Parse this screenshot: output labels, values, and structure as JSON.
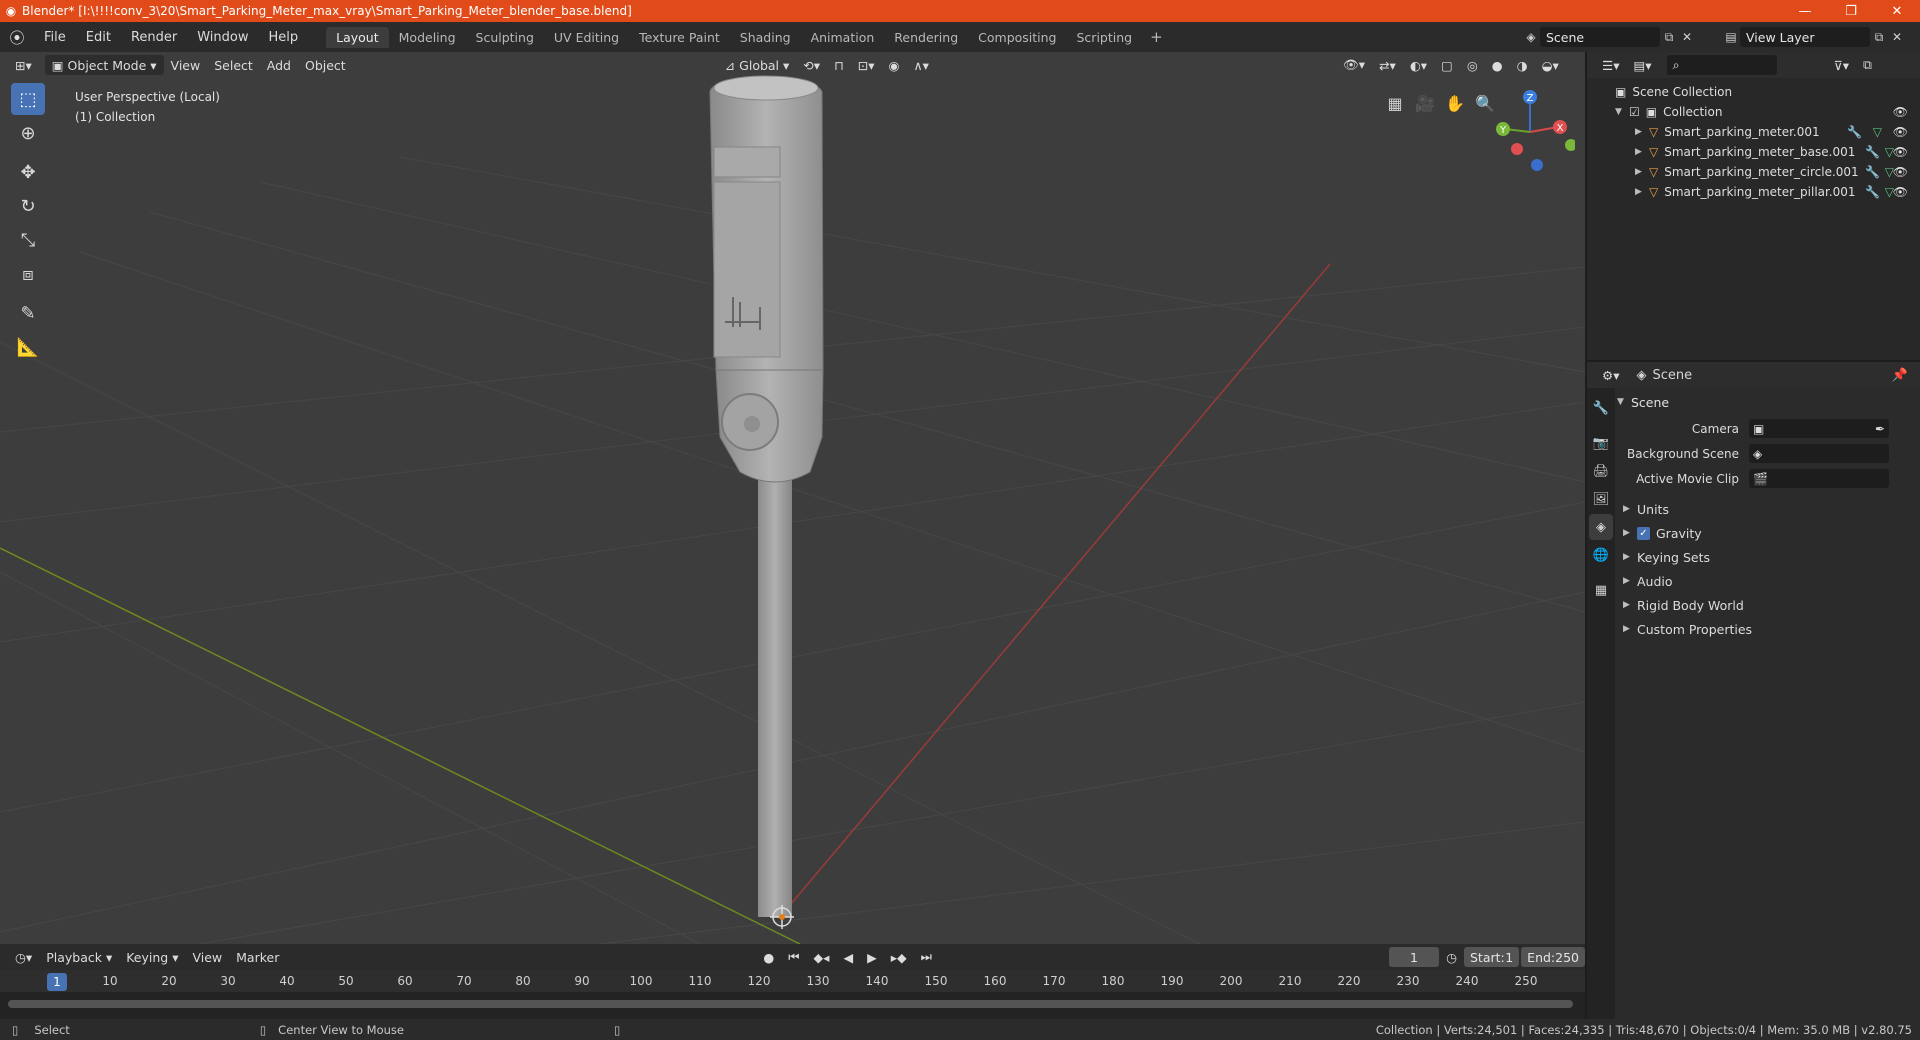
{
  "window": {
    "title": "Blender* [I:\\!!!!conv_3\\20\\Smart_Parking_Meter_max_vray\\Smart_Parking_Meter_blender_base.blend]",
    "min": "—",
    "max": "❐",
    "close": "✕"
  },
  "menu": [
    "File",
    "Edit",
    "Render",
    "Window",
    "Help"
  ],
  "workspaces": [
    "Layout",
    "Modeling",
    "Sculpting",
    "UV Editing",
    "Texture Paint",
    "Shading",
    "Animation",
    "Rendering",
    "Compositing",
    "Scripting"
  ],
  "scene_name": "Scene",
  "view_layer": "View Layer",
  "viewport": {
    "mode": "Object Mode",
    "menus": [
      "View",
      "Select",
      "Add",
      "Object"
    ],
    "transform_orientation": "Global",
    "perspective_label": "User Perspective (Local)",
    "collection_label": "(1) Collection",
    "gizmo": {
      "x": "X",
      "y": "Y",
      "z": "Z"
    }
  },
  "timeline": {
    "menus": [
      "Playback",
      "Keying",
      "View",
      "Marker"
    ],
    "current_frame": "1",
    "start_label": "Start:",
    "start": "1",
    "end_label": "End:",
    "end": "250",
    "ticks": [
      "10",
      "20",
      "30",
      "40",
      "50",
      "60",
      "70",
      "80",
      "90",
      "100",
      "110",
      "120",
      "130",
      "140",
      "150",
      "160",
      "170",
      "180",
      "190",
      "200",
      "210",
      "220",
      "230",
      "240",
      "250"
    ]
  },
  "status": {
    "left": "Select",
    "middle": "Center View to Mouse",
    "right": "Collection | Verts:24,501 | Faces:24,335 | Tris:48,670 | Objects:0/4 | Mem: 35.0 MB | v2.80.75"
  },
  "outliner": {
    "root": "Scene Collection",
    "collection": "Collection",
    "items": [
      "Smart_parking_meter.001",
      "Smart_parking_meter_base.001",
      "Smart_parking_meter_circle.001",
      "Smart_parking_meter_pillar.001"
    ]
  },
  "properties": {
    "header": "Scene",
    "section": "Scene",
    "camera_label": "Camera",
    "background_label": "Background Scene",
    "movie_clip_label": "Active Movie Clip",
    "subsections": [
      "Units",
      "Gravity",
      "Keying Sets",
      "Audio",
      "Rigid Body World",
      "Custom Properties"
    ]
  }
}
